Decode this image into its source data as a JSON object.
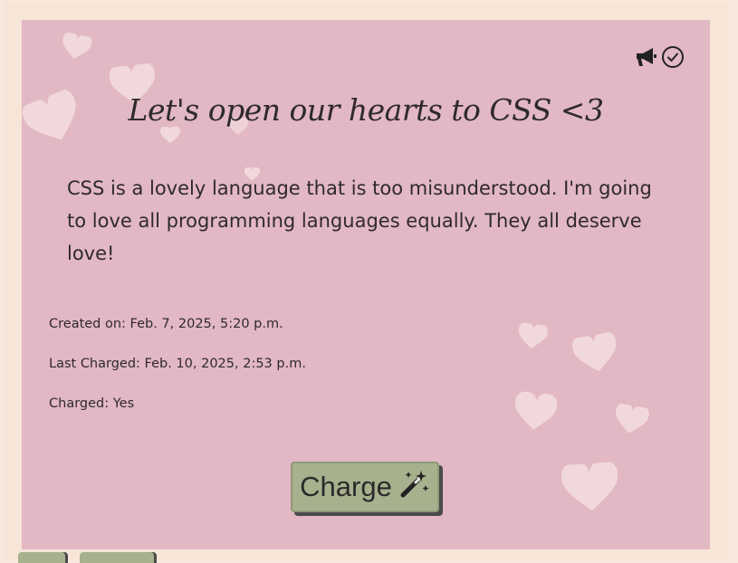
{
  "card": {
    "title": "Let's open our hearts to CSS <3",
    "body": "CSS is a lovely language that is too misunderstood. I'm going to love all programming languages equally. They all deserve love!",
    "created_on": "Created on: Feb. 7, 2025, 5:20 p.m.",
    "last_charged": "Last Charged: Feb. 10, 2025, 2:53 p.m.",
    "charged": "Charged: Yes"
  },
  "actions": {
    "charge_label": "Charge"
  },
  "icons": {
    "announce": "megaphone-icon",
    "status": "check-circle-icon",
    "charge": "magic-wand-icon"
  },
  "colors": {
    "page_background": "#f9e9dd",
    "card_background": "#e2b8c4",
    "heart": "#f3dde1",
    "button": "#a8b18e",
    "text": "#2f2a2c"
  }
}
